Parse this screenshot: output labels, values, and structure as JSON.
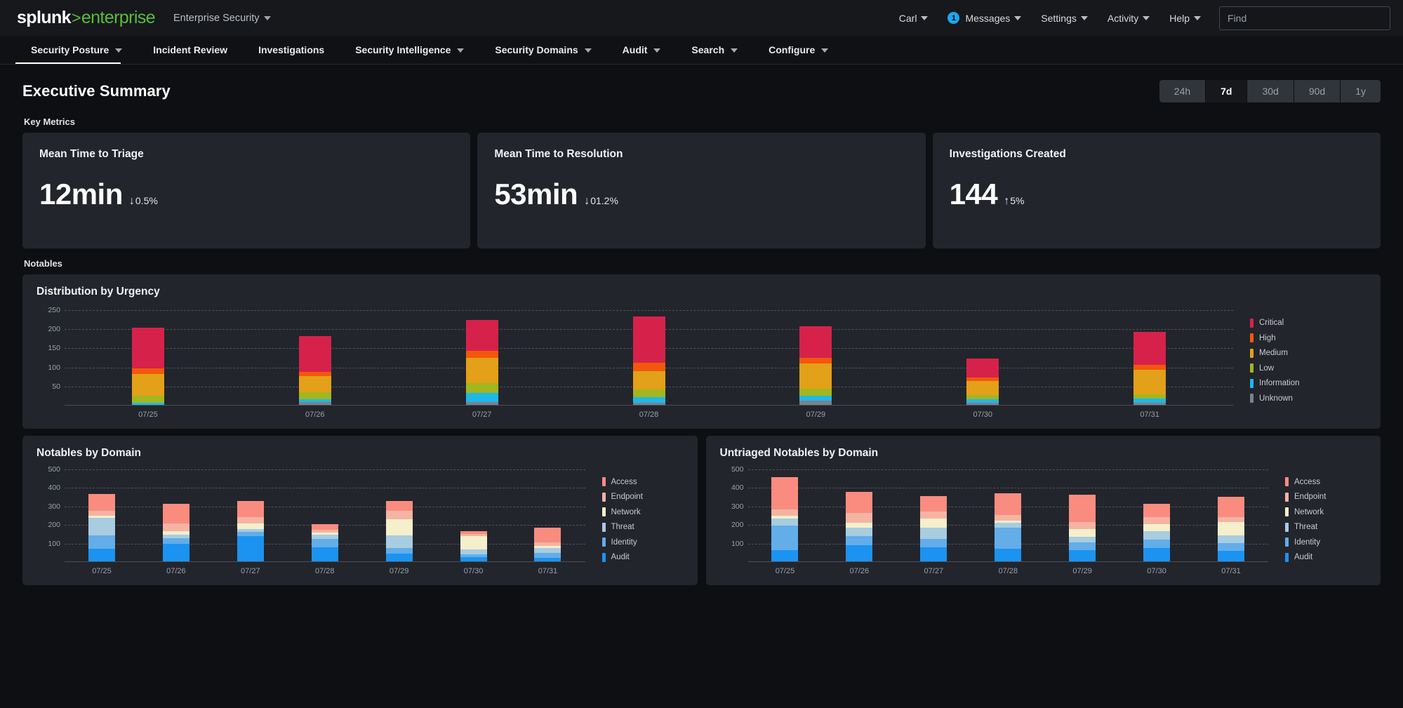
{
  "header": {
    "logo": {
      "splunk": "splunk",
      "sep": ">",
      "enterprise": "enterprise"
    },
    "app_name": "Enterprise Security",
    "user": "Carl",
    "messages_label": "Messages",
    "messages_count": "1",
    "settings": "Settings",
    "activity": "Activity",
    "help": "Help",
    "find_placeholder": "Find"
  },
  "nav": {
    "items": [
      {
        "label": "Security Posture",
        "caret": true,
        "active": true
      },
      {
        "label": "Incident Review",
        "caret": false,
        "active": false
      },
      {
        "label": "Investigations",
        "caret": false,
        "active": false
      },
      {
        "label": "Security Intelligence",
        "caret": true,
        "active": false
      },
      {
        "label": "Security Domains",
        "caret": true,
        "active": false
      },
      {
        "label": "Audit",
        "caret": true,
        "active": false
      },
      {
        "label": "Search",
        "caret": true,
        "active": false
      },
      {
        "label": "Configure",
        "caret": true,
        "active": false
      }
    ]
  },
  "page": {
    "title": "Executive Summary",
    "time_range": {
      "options": [
        "24h",
        "7d",
        "30d",
        "90d",
        "1y"
      ],
      "selected": "7d"
    },
    "key_metrics_label": "Key Metrics",
    "notables_label": "Notables"
  },
  "metrics": [
    {
      "title": "Mean Time to Triage",
      "value": "12min",
      "arrow": "↓",
      "delta": "0.5%",
      "direction": "down"
    },
    {
      "title": "Mean Time to Resolution",
      "value": "53min",
      "arrow": "↓",
      "delta": "01.2%",
      "direction": "down"
    },
    {
      "title": "Investigations Created",
      "value": "144",
      "arrow": "↑",
      "delta": "5%",
      "direction": "up"
    }
  ],
  "chart_data": [
    {
      "id": "urgency",
      "type": "bar",
      "stacked": true,
      "title": "Distribution by Urgency",
      "xlabel": "",
      "ylabel": "",
      "ylim": [
        0,
        270
      ],
      "yticks": [
        50,
        100,
        150,
        200,
        250
      ],
      "grid": true,
      "legend_position": "right",
      "categories": [
        "07/25",
        "07/26",
        "07/27",
        "07/28",
        "07/29",
        "07/30",
        "07/31"
      ],
      "series": [
        {
          "name": "Unknown",
          "color": "#7b8190",
          "values": [
            0,
            7,
            7,
            6,
            11,
            6,
            6
          ]
        },
        {
          "name": "Information",
          "color": "#1eb8e8",
          "values": [
            6,
            8,
            24,
            14,
            13,
            9,
            10
          ]
        },
        {
          "name": "Low",
          "color": "#a2b61e",
          "values": [
            17,
            18,
            26,
            20,
            19,
            11,
            12
          ]
        },
        {
          "name": "Medium",
          "color": "#e3a019",
          "values": [
            58,
            42,
            67,
            48,
            66,
            36,
            63
          ]
        },
        {
          "name": "High",
          "color": "#f2580c",
          "values": [
            14,
            11,
            17,
            23,
            15,
            10,
            13
          ]
        },
        {
          "name": "Critical",
          "color": "#d6224b",
          "values": [
            107,
            95,
            82,
            121,
            81,
            50,
            87
          ]
        }
      ]
    },
    {
      "id": "notables-by-domain",
      "type": "bar",
      "stacked": true,
      "title": "Notables by Domain",
      "xlabel": "",
      "ylabel": "",
      "ylim": [
        0,
        530
      ],
      "yticks": [
        100,
        200,
        300,
        400,
        500
      ],
      "grid": true,
      "legend_position": "right",
      "categories": [
        "07/25",
        "07/26",
        "07/27",
        "07/28",
        "07/29",
        "07/30",
        "07/31"
      ],
      "series": [
        {
          "name": "Audit",
          "color": "#1b93f0",
          "values": [
            70,
            93,
            135,
            75,
            40,
            22,
            20
          ]
        },
        {
          "name": "Identity",
          "color": "#63ade8",
          "values": [
            70,
            32,
            23,
            45,
            32,
            15,
            27
          ]
        },
        {
          "name": "Threat",
          "color": "#a8cce0",
          "values": [
            95,
            20,
            16,
            23,
            70,
            28,
            25
          ]
        },
        {
          "name": "Network",
          "color": "#f5efcb",
          "values": [
            12,
            17,
            29,
            14,
            85,
            72,
            12
          ]
        },
        {
          "name": "Endpoint",
          "color": "#f5b3a3",
          "values": [
            25,
            43,
            37,
            12,
            45,
            10,
            18
          ]
        },
        {
          "name": "Access",
          "color": "#f98c7f",
          "values": [
            90,
            105,
            85,
            32,
            55,
            15,
            80
          ]
        }
      ]
    },
    {
      "id": "untriaged-notables-by-domain",
      "type": "bar",
      "stacked": true,
      "title": "Untriaged Notables by Domain",
      "xlabel": "",
      "ylabel": "",
      "ylim": [
        0,
        530
      ],
      "yticks": [
        100,
        200,
        300,
        400,
        500
      ],
      "grid": true,
      "legend_position": "right",
      "categories": [
        "07/25",
        "07/26",
        "07/27",
        "07/28",
        "07/29",
        "07/30",
        "07/31"
      ],
      "series": [
        {
          "name": "Audit",
          "color": "#1b93f0",
          "values": [
            60,
            88,
            75,
            70,
            60,
            72,
            55
          ]
        },
        {
          "name": "Identity",
          "color": "#63ade8",
          "values": [
            135,
            50,
            45,
            110,
            42,
            45,
            42
          ]
        },
        {
          "name": "Threat",
          "color": "#a8cce0",
          "values": [
            35,
            42,
            60,
            28,
            32,
            45,
            45
          ]
        },
        {
          "name": "Network",
          "color": "#f5efcb",
          "values": [
            17,
            27,
            50,
            13,
            40,
            40,
            70
          ]
        },
        {
          "name": "Endpoint",
          "color": "#f5b3a3",
          "values": [
            35,
            53,
            38,
            30,
            40,
            38,
            28
          ]
        },
        {
          "name": "Access",
          "color": "#f98c7f",
          "values": [
            173,
            115,
            85,
            118,
            145,
            70,
            110
          ]
        }
      ]
    }
  ]
}
